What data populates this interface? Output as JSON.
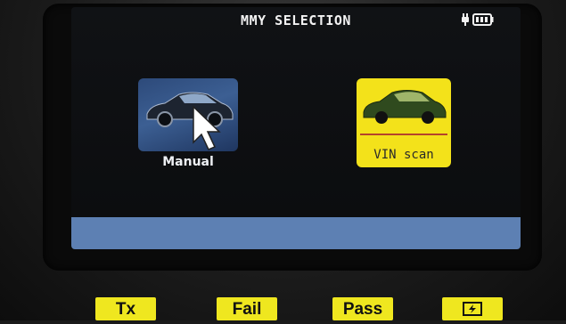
{
  "screen": {
    "title": "MMY SELECTION",
    "icons": [
      "plug-icon",
      "battery-icon"
    ]
  },
  "options": [
    {
      "id": "manual",
      "label": "Manual",
      "icon": "car-cursor-icon",
      "selected": false,
      "tile_color": "#3c5f93"
    },
    {
      "id": "vin",
      "label": "VIN scan",
      "icon": "car-icon",
      "selected": true,
      "tile_color": "#f3e21a"
    }
  ],
  "keys": {
    "tx": "Tx",
    "fail": "Fail",
    "pass": "Pass",
    "power_icon": "battery-charge-icon"
  },
  "colors": {
    "status_bar": "#5d80b3",
    "key_yellow": "#efe71f",
    "selected_tile": "#f3e21a"
  }
}
